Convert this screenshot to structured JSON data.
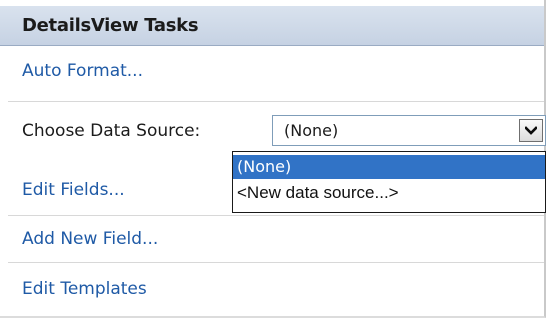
{
  "panel": {
    "title": "DetailsView Tasks"
  },
  "tasks": {
    "auto_format": "Auto Format...",
    "choose_data_source_label": "Choose Data Source:",
    "edit_fields": "Edit Fields...",
    "add_new_field": "Add New Field...",
    "edit_templates": "Edit Templates"
  },
  "data_source_select": {
    "selected_value": "(None)",
    "options": [
      "(None)",
      "<New data source...>"
    ],
    "highlighted_option": "(None)"
  },
  "colors": {
    "header_bg": "#c6d2e3",
    "link": "#1f5aa6",
    "highlight": "#3173c6"
  },
  "icons": {
    "dropdown_arrow": "chevron-down-icon"
  }
}
